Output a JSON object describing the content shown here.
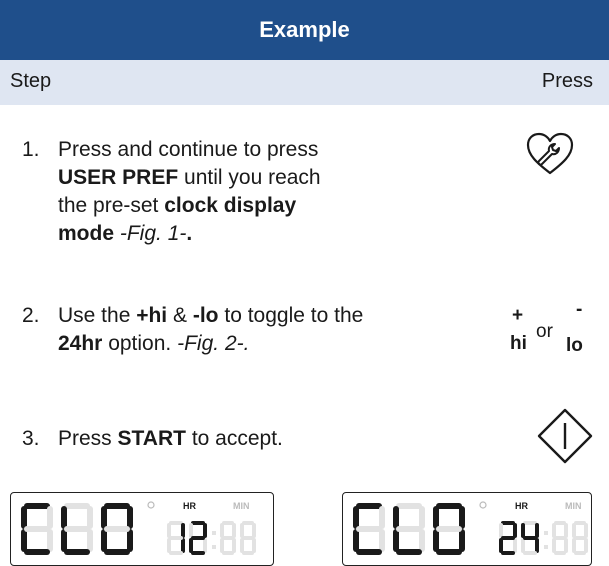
{
  "header": {
    "title": "Example"
  },
  "columns": {
    "step": "Step",
    "press": "Press"
  },
  "steps": [
    {
      "num": "1.",
      "parts": [
        "Press and continue to press",
        "USER PREF",
        "until you reach",
        "the pre-set",
        "clock display",
        "mode",
        "-Fig. 1-",
        "."
      ],
      "icon": "wrench-heart-icon"
    },
    {
      "num": "2.",
      "parts": [
        "Use the",
        "+hi",
        "&",
        "-lo",
        "to toggle to the",
        "24hr",
        "option.",
        "-Fig. 2-."
      ],
      "icon": "hi-or-lo-buttons"
    },
    {
      "num": "3.",
      "parts": [
        "Press",
        "START",
        "to accept."
      ],
      "icon": "start-diamond-icon"
    }
  ],
  "hilo": {
    "plus": "+",
    "hi": "hi",
    "or": "or",
    "minus": "-",
    "lo": "lo"
  },
  "displays": [
    {
      "main": "CLO",
      "hr_label": "HR",
      "min_label": "MIN",
      "value": "12"
    },
    {
      "main": "CLO",
      "hr_label": "HR",
      "min_label": "MIN",
      "value": "24"
    }
  ],
  "colors": {
    "header_bg": "#1f4f8b",
    "subheader_bg": "#dfe6f2",
    "lcd_dim": "#e2e2e2"
  }
}
